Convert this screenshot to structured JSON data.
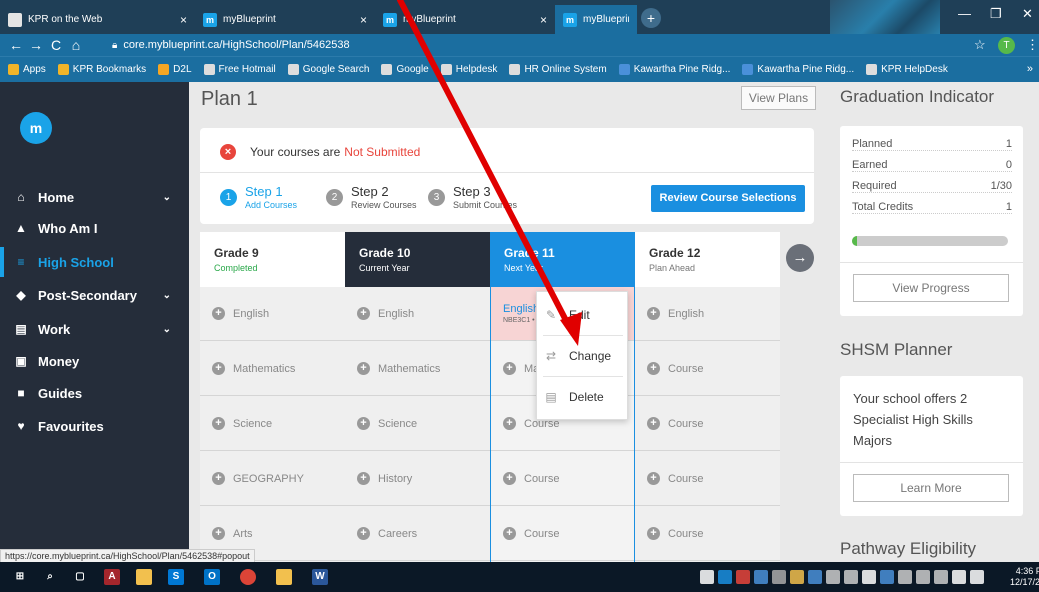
{
  "browser": {
    "tabs": [
      {
        "title": "KPR on the Web",
        "icon": "document-icon"
      },
      {
        "title": "myBlueprint",
        "icon": "myblueprint-icon"
      },
      {
        "title": "myBlueprint",
        "icon": "myblueprint-icon"
      },
      {
        "title": "myBlueprint: High School",
        "icon": "myblueprint-icon"
      }
    ],
    "url": "core.myblueprint.ca/HighSchool/Plan/5462538",
    "profile_initial": "T",
    "bookmarks": [
      {
        "label": "Apps",
        "color": "#f0b429"
      },
      {
        "label": "KPR Bookmarks",
        "color": "#f0b429"
      },
      {
        "label": "D2L",
        "color": "#f5a623"
      },
      {
        "label": "Free Hotmail",
        "color": "#dddddd"
      },
      {
        "label": "Google Search",
        "color": "#dddddd"
      },
      {
        "label": "Google",
        "color": "#dddddd"
      },
      {
        "label": "Helpdesk",
        "color": "#dddddd"
      },
      {
        "label": "HR Online System",
        "color": "#dddddd"
      },
      {
        "label": "Kawartha Pine Ridg...",
        "color": "#4a90d9"
      },
      {
        "label": "Kawartha Pine Ridg...",
        "color": "#4a90d9"
      },
      {
        "label": "KPR HelpDesk",
        "color": "#dddddd"
      }
    ]
  },
  "sidebar": {
    "logo": "m",
    "items": [
      {
        "label": "Home",
        "icon": "home-icon",
        "glyph": "⌂",
        "chevron": true
      },
      {
        "label": "Who Am I",
        "icon": "who-am-i-icon",
        "glyph": "▲",
        "chevron": false
      },
      {
        "label": "High School",
        "icon": "high-school-icon",
        "glyph": "≡",
        "chevron": false,
        "active": true
      },
      {
        "label": "Post-Secondary",
        "icon": "graduation-cap-icon",
        "glyph": "◆",
        "chevron": true
      },
      {
        "label": "Work",
        "icon": "briefcase-icon",
        "glyph": "▤",
        "chevron": true
      },
      {
        "label": "Money",
        "icon": "money-icon",
        "glyph": "▣",
        "chevron": false
      },
      {
        "label": "Guides",
        "icon": "book-icon",
        "glyph": "■",
        "chevron": false
      },
      {
        "label": "Favourites",
        "icon": "heart-icon",
        "glyph": "♥",
        "chevron": false
      }
    ]
  },
  "main": {
    "title": "Plan 1",
    "view_plans": "View Plans",
    "status_prefix": "Your courses are",
    "status_value": "Not Submitted",
    "steps": [
      {
        "num": "1",
        "title": "Step 1",
        "sub": "Add Courses"
      },
      {
        "num": "2",
        "title": "Step 2",
        "sub": "Review Courses"
      },
      {
        "num": "3",
        "title": "Step 3",
        "sub": "Submit Courses"
      }
    ],
    "review_button": "Review Course Selections",
    "grades": [
      {
        "name": "Grade 9",
        "sub": "Completed",
        "bg": "#ffffff",
        "fg": "#333333",
        "subfg": "#2aa84a"
      },
      {
        "name": "Grade 10",
        "sub": "Current Year",
        "bg": "#252d3a",
        "fg": "#ffffff",
        "subfg": "#ffffff"
      },
      {
        "name": "Grade 11",
        "sub": "Next Year",
        "bg": "#1a8fe0",
        "fg": "#ffffff",
        "subfg": "#ffffff"
      },
      {
        "name": "Grade 12",
        "sub": "Plan Ahead",
        "bg": "#ffffff",
        "fg": "#333333",
        "subfg": "#777777"
      }
    ],
    "courses": [
      [
        "English",
        "Mathematics",
        "Science",
        "GEOGRAPHY",
        "Arts"
      ],
      [
        "English",
        "Mathematics",
        "Science",
        "History",
        "Careers"
      ],
      [
        "English",
        "Ma",
        "Course",
        "Course",
        "Course"
      ],
      [
        "English",
        "Course",
        "Course",
        "Course",
        "Course"
      ]
    ],
    "selected_course": {
      "name": "English",
      "code": "NBE3C1 •"
    },
    "next_arrow": "→",
    "popup": [
      {
        "label": "Edit",
        "icon": "pencil-icon",
        "glyph": "✎"
      },
      {
        "label": "Change",
        "icon": "swap-icon",
        "glyph": "⇄"
      },
      {
        "label": "Delete",
        "icon": "trash-icon",
        "glyph": "▤"
      }
    ]
  },
  "graduation": {
    "title": "Graduation Indicator",
    "rows": [
      {
        "label": "Planned",
        "value": "1"
      },
      {
        "label": "Earned",
        "value": "0"
      },
      {
        "label": "Required",
        "value": "1/30"
      },
      {
        "label": "Total Credits",
        "value": "1"
      }
    ],
    "progress_fraction": 0.033,
    "progress_color": "#57b94a",
    "view_progress": "View Progress"
  },
  "shsm": {
    "title": "SHSM Planner",
    "text": "Your school offers 2 Specialist High Skills Majors",
    "learn_more": "Learn More"
  },
  "pathway": {
    "title": "Pathway Eligibility"
  },
  "status_bar_url": "https://core.myblueprint.ca/HighSchool/Plan/5462538#popout",
  "taskbar": {
    "time": "4:36 PM",
    "date": "12/17/2019"
  },
  "colors": {
    "accent": "#1aa3e8",
    "sidebar_bg": "#252d3a",
    "error": "#e8453c",
    "annotation": "#e00000"
  }
}
